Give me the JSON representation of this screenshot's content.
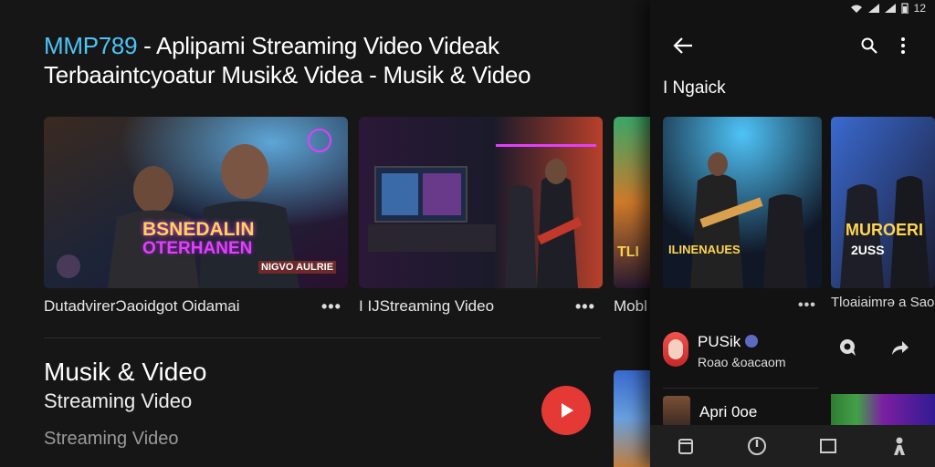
{
  "main": {
    "title_brand": "MMP789",
    "title_rest": " - Aplipami Streaming Video Videak",
    "title_line2": "Terbaaintcyoatur Musik& Videa - Musik & Video",
    "cards": [
      {
        "label": "DutadvirerƆaoidgot Oidamai",
        "overlay_title": "BSNEDALIN",
        "overlay_sub": "OTERHANEN",
        "overlay_tag": "NIGVO AULRIE"
      },
      {
        "label": "I IJStreaming Video"
      },
      {
        "label": "Mobl",
        "overlay_text": "TLI"
      }
    ],
    "menu_dots": "•••",
    "section": {
      "title": "Musik & Video",
      "subtitle": "Streaming Video",
      "meta": "Streaming Video"
    }
  },
  "panel": {
    "status": {
      "time": "12"
    },
    "header": "I Ngaick",
    "cards": [
      {
        "overlay_text": "ILINENAUES"
      },
      {
        "overlay_title": "MUROERI",
        "overlay_sub": "2USS"
      }
    ],
    "dots": "•••",
    "label": "Tloaiaimrə a Sao",
    "channel": {
      "name": "PUSik",
      "sub": "Roao &oacaom"
    },
    "channel2": {
      "name": "Apri 0oe"
    }
  },
  "colors": {
    "brand": "#4fc3f7",
    "play": "#e53935",
    "accent_pink": "#e040fb",
    "accent_yellow": "#ffd54f"
  },
  "icons": [
    "back-arrow-icon",
    "search-icon",
    "more-vert-icon",
    "play-icon",
    "comment-icon",
    "share-icon",
    "home-icon",
    "compass-icon",
    "library-icon",
    "profile-icon",
    "wifi-icon",
    "signal-icon",
    "battery-icon"
  ]
}
